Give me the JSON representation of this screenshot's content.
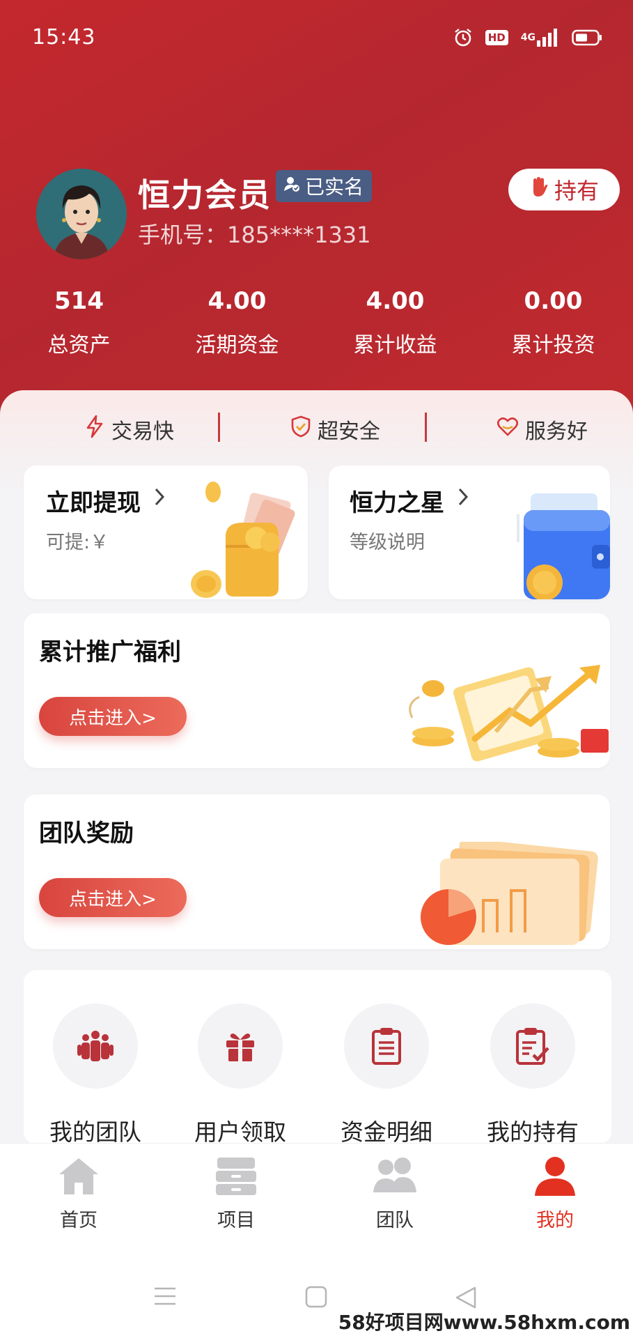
{
  "status_bar": {
    "time": "15:43",
    "hd": "HD",
    "network": "4G"
  },
  "profile": {
    "name": "恒力会员",
    "verified_label": "已实名",
    "phone": "手机号：185****1331",
    "holdings_button": "持有"
  },
  "stats": [
    {
      "value": "514",
      "label": "总资产"
    },
    {
      "value": "4.00",
      "label": "活期资金"
    },
    {
      "value": "4.00",
      "label": "累计收益"
    },
    {
      "value": "0.00",
      "label": "累计投资"
    }
  ],
  "features": [
    {
      "label": "交易快",
      "icon": "lightning-icon"
    },
    {
      "label": "超安全",
      "icon": "shield-check-icon"
    },
    {
      "label": "服务好",
      "icon": "heart-icon"
    }
  ],
  "cards": {
    "withdraw": {
      "title": "立即提现",
      "subtitle": "可提:￥"
    },
    "star": {
      "title": "恒力之星",
      "subtitle": "等级说明"
    },
    "promo": {
      "title": "累计推广福利",
      "button": "点击进入>"
    },
    "team": {
      "title": "团队奖励",
      "button": "点击进入>"
    }
  },
  "menu": [
    {
      "label": "我的团队",
      "icon": "team-icon"
    },
    {
      "label": "用户领取",
      "icon": "gift-icon"
    },
    {
      "label": "资金明细",
      "icon": "clipboard-icon"
    },
    {
      "label": "我的持有",
      "icon": "checklist-icon"
    }
  ],
  "tabs": [
    {
      "label": "首页",
      "icon": "home-icon",
      "active": false
    },
    {
      "label": "项目",
      "icon": "drawer-icon",
      "active": false
    },
    {
      "label": "团队",
      "icon": "group-icon",
      "active": false
    },
    {
      "label": "我的",
      "icon": "user-icon",
      "active": true
    }
  ],
  "watermark": "58好项目网www.58hxm.com",
  "colors": {
    "primary": "#c0272d",
    "accent": "#e23121",
    "badge": "#4a5d84"
  }
}
